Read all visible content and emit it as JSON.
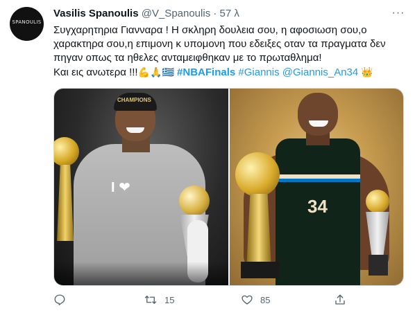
{
  "tweet": {
    "avatar_text": "SPANOULIS",
    "name": "Vasilis Spanoulis",
    "handle": "@V_Spanoulis",
    "separator": "·",
    "time": "57 λ",
    "more_label": "···",
    "text": {
      "line1": "Συγχαρητηρια Γιανναρα ! Η σκληρη δουλεια σου, η αφοσιωση σου,ο",
      "line2": "χαρακτηρα σου,η επιμονη κ υπομονη που εδειξες οταν τα πραγματα δεν",
      "line3": "πηγαν οπως τα ηθελες ανταμειφθηκαν με το πρωταθλημα!",
      "line4_text": "Και εις ανωτερα !!!",
      "line4_emojis": "💪🙏🇬🇷",
      "hashtag": "#NBAFinals",
      "hashtag2": "#Giannis",
      "mention": "@Giannis_An34",
      "crown": "👑"
    },
    "images": {
      "left": {
        "cap_text": "CHAMPIONS",
        "shirt_text": "I ❤"
      },
      "right": {
        "jersey_number": "34"
      }
    },
    "actions": {
      "reply_count": "",
      "retweet_count": "15",
      "like_count": "85",
      "share_count": ""
    }
  },
  "colors": {
    "accent": "#1d9bf0",
    "secondary_text": "#536471",
    "primary_text": "#0f1419"
  },
  "icons": [
    "reply-icon",
    "retweet-icon",
    "like-icon",
    "share-icon",
    "more-icon"
  ]
}
